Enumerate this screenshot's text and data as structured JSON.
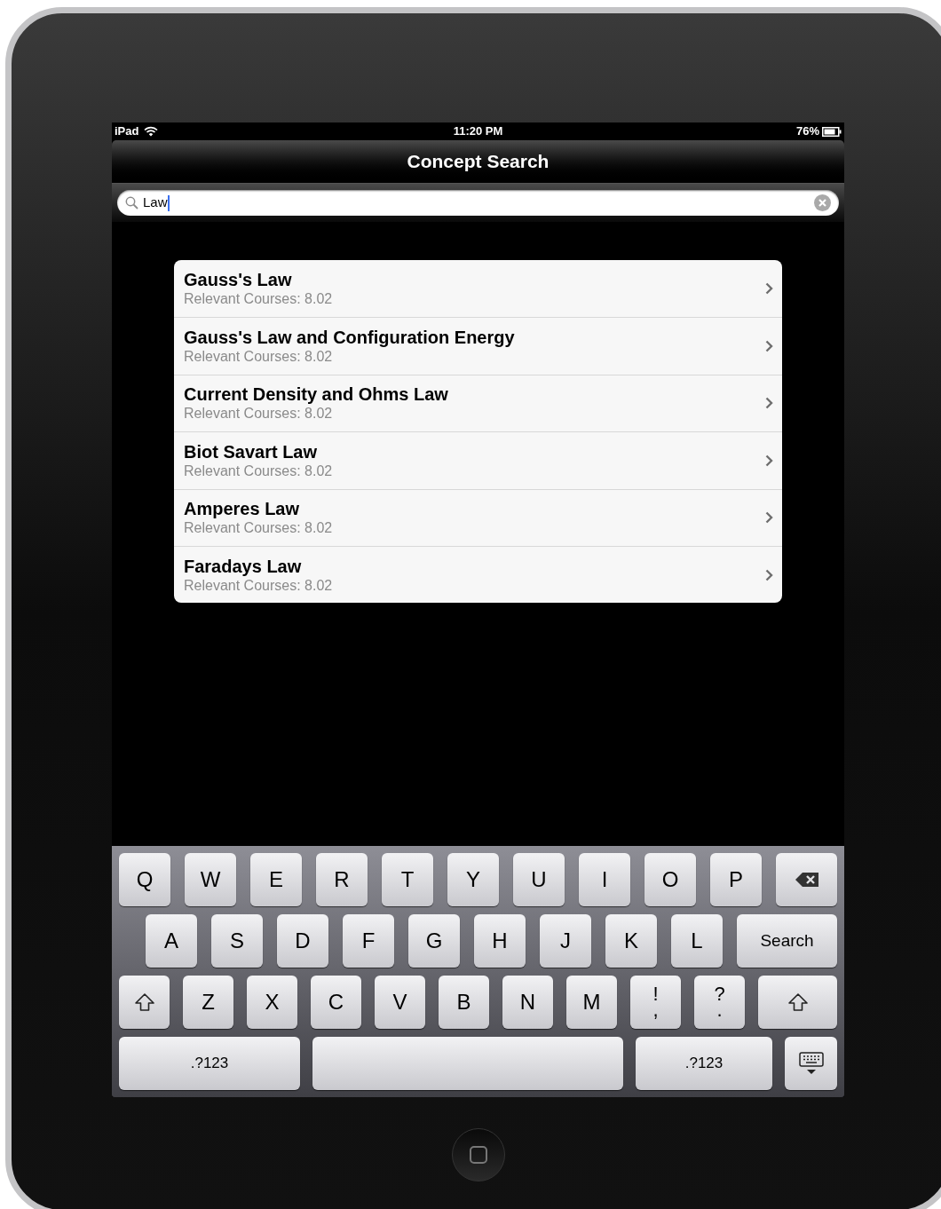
{
  "status_bar": {
    "carrier": "iPad",
    "time": "11:20 PM",
    "battery": "76%"
  },
  "nav_bar": {
    "title": "Concept Search"
  },
  "search": {
    "value": "Law"
  },
  "results": [
    {
      "title": "Gauss's Law",
      "subtitle": "Relevant Courses: 8.02"
    },
    {
      "title": "Gauss's Law and Configuration Energy",
      "subtitle": "Relevant Courses: 8.02"
    },
    {
      "title": "Current Density and Ohms Law",
      "subtitle": "Relevant Courses: 8.02"
    },
    {
      "title": "Biot Savart Law",
      "subtitle": "Relevant Courses: 8.02"
    },
    {
      "title": "Amperes Law",
      "subtitle": "Relevant Courses: 8.02"
    },
    {
      "title": "Faradays Law",
      "subtitle": "Relevant Courses: 8.02"
    }
  ],
  "keyboard": {
    "rows": [
      {
        "keys": [
          {
            "kind": "letter",
            "label": "Q"
          },
          {
            "kind": "letter",
            "label": "W"
          },
          {
            "kind": "letter",
            "label": "E"
          },
          {
            "kind": "letter",
            "label": "R"
          },
          {
            "kind": "letter",
            "label": "T"
          },
          {
            "kind": "letter",
            "label": "Y"
          },
          {
            "kind": "letter",
            "label": "U"
          },
          {
            "kind": "letter",
            "label": "I"
          },
          {
            "kind": "letter",
            "label": "O"
          },
          {
            "kind": "letter",
            "label": "P"
          },
          {
            "kind": "backspace"
          }
        ]
      },
      {
        "keys": [
          {
            "kind": "letter",
            "label": "A"
          },
          {
            "kind": "letter",
            "label": "S"
          },
          {
            "kind": "letter",
            "label": "D"
          },
          {
            "kind": "letter",
            "label": "F"
          },
          {
            "kind": "letter",
            "label": "G"
          },
          {
            "kind": "letter",
            "label": "H"
          },
          {
            "kind": "letter",
            "label": "J"
          },
          {
            "kind": "letter",
            "label": "K"
          },
          {
            "kind": "letter",
            "label": "L"
          },
          {
            "kind": "action",
            "label": "Search"
          }
        ]
      },
      {
        "keys": [
          {
            "kind": "shift"
          },
          {
            "kind": "letter",
            "label": "Z"
          },
          {
            "kind": "letter",
            "label": "X"
          },
          {
            "kind": "letter",
            "label": "C"
          },
          {
            "kind": "letter",
            "label": "V"
          },
          {
            "kind": "letter",
            "label": "B"
          },
          {
            "kind": "letter",
            "label": "N"
          },
          {
            "kind": "letter",
            "label": "M"
          },
          {
            "kind": "punct",
            "top": "!",
            "bottom": ","
          },
          {
            "kind": "punct",
            "top": "?",
            "bottom": "."
          },
          {
            "kind": "shift"
          }
        ]
      },
      {
        "keys": [
          {
            "kind": "mode",
            "label": ".?123"
          },
          {
            "kind": "space"
          },
          {
            "kind": "mode",
            "label": ".?123"
          },
          {
            "kind": "dismiss"
          }
        ]
      }
    ]
  }
}
